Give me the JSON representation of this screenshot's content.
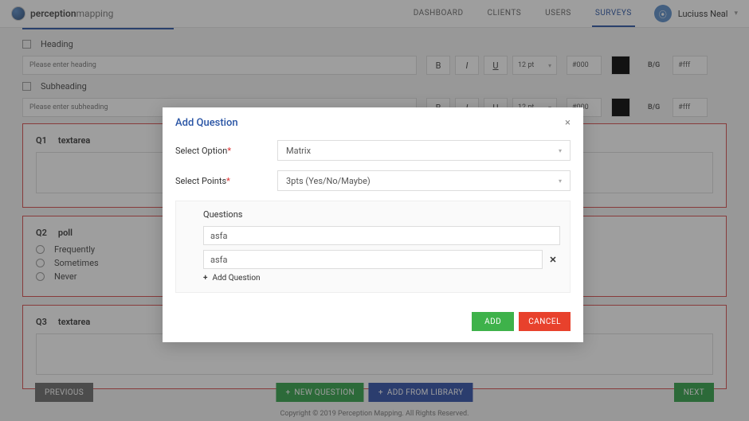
{
  "header": {
    "brand_prefix": "perception",
    "brand_suffix": "mapping",
    "nav": {
      "dashboard": "DASHBOARD",
      "clients": "CLIENTS",
      "users": "USERS",
      "surveys": "SURVEYS"
    },
    "user_name": "Luciuss Neal"
  },
  "form": {
    "heading_label": "Heading",
    "heading_placeholder": "Please enter heading",
    "subheading_label": "Subheading",
    "subheading_placeholder": "Please enter subheading",
    "bold": "B",
    "italic": "I",
    "underline": "U",
    "fontsize": "12 pt",
    "color_val": "#000",
    "bg_label": "B/G",
    "bg_val": "#fff"
  },
  "questions": {
    "q1": {
      "num": "Q1",
      "type": "textarea"
    },
    "q2": {
      "num": "Q2",
      "type": "poll",
      "opt1": "Frequently",
      "opt2": "Sometimes",
      "opt3": "Never"
    },
    "q3": {
      "num": "Q3",
      "type": "textarea"
    }
  },
  "footer": {
    "prev": "PREVIOUS",
    "newq": "NEW QUESTION",
    "addlib": "ADD FROM LIBRARY",
    "next": "NEXT",
    "copyright": "Copyright © 2019 Perception Mapping. All Rights Reserved."
  },
  "modal": {
    "title": "Add Question",
    "select_option_label": "Select Option",
    "select_option_value": "Matrix",
    "select_points_label": "Select Points",
    "select_points_value": "3pts (Yes/No/Maybe)",
    "questions_header": "Questions",
    "q1_value": "asfa",
    "q2_value": "asfa",
    "add_question": "Add Question",
    "add_btn": "ADD",
    "cancel_btn": "CANCEL"
  }
}
